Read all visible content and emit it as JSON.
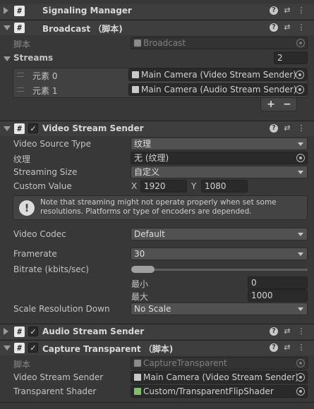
{
  "components": [
    {
      "title": "Signaling Manager",
      "expanded": false,
      "has_checkbox": false
    },
    {
      "title": "Broadcast （脚本)",
      "expanded": true,
      "has_checkbox": false
    },
    {
      "title": "Video Stream Sender",
      "expanded": true,
      "has_checkbox": true,
      "checked": true
    },
    {
      "title": "Audio Stream Sender",
      "expanded": false,
      "has_checkbox": true,
      "checked": true
    },
    {
      "title": "Capture Transparent （脚本)",
      "expanded": true,
      "has_checkbox": true,
      "checked": true
    }
  ],
  "header_icons": [
    "help-icon",
    "preset-icon",
    "more-icon"
  ],
  "icon_glyphs": {
    "script": "#",
    "check": "✓",
    "help": "?",
    "preset": "⇄",
    "more": "⋮"
  },
  "broadcast": {
    "script_label": "脚本",
    "script_value": "Broadcast",
    "streams_label": "Streams",
    "streams_count": "2",
    "elements": [
      {
        "label": "元素 0",
        "value": "Main Camera (Video Stream Sender)"
      },
      {
        "label": "元素 1",
        "value": "Main Camera (Audio Stream Sender)"
      }
    ],
    "add_label": "+",
    "remove_label": "−"
  },
  "video": {
    "source_type_label": "Video Source Type",
    "source_type_value": "纹理",
    "texture_label": "纹理",
    "texture_value": "无 (纹理)",
    "streaming_size_label": "Streaming Size",
    "streaming_size_value": "自定义",
    "custom_value_label": "Custom Value",
    "x_label": "X",
    "x_value": "1920",
    "y_label": "Y",
    "y_value": "1080",
    "warning_text": "Note that streaming might not operate properly when set some resolutions. Platforms or type of encoders are depended.",
    "warning_icon": "!",
    "codec_label": "Video Codec",
    "codec_value": "Default",
    "framerate_label": "Framerate",
    "framerate_value": "30",
    "bitrate_label": "Bitrate (kbits/sec)",
    "bitrate_min_label": "最小",
    "bitrate_min_value": "0",
    "bitrate_max_label": "最大",
    "bitrate_max_value": "1000",
    "bitrate_fraction": 0.13,
    "scale_label": "Scale Resolution Down",
    "scale_value": "No Scale"
  },
  "capture": {
    "script_label": "脚本",
    "script_value": "CaptureTransparent",
    "sender_label": "Video Stream Sender",
    "sender_value": "Main Camera (Video Stream Sender)",
    "shader_label": "Transparent Shader",
    "shader_value": "Custom/TransparentFlipShader"
  },
  "colors": {
    "background": "#383838",
    "header": "#3e3e3e",
    "field": "#2a2a2a",
    "dropdown": "#515151"
  }
}
